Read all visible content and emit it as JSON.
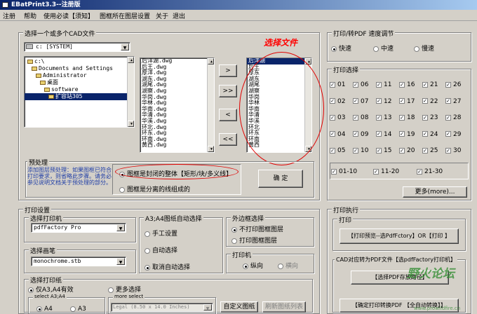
{
  "window": {
    "title": "EBatPrint3.3--注册版"
  },
  "menu": [
    "注册",
    "帮助",
    "使用必读【须知】",
    "图框所在图层设置",
    "关于",
    "退出"
  ],
  "file_section": {
    "label": "选择一个或多个CAD文件",
    "drive": "c: [SYSTEM]",
    "tree": [
      "c:\\",
      "Documents and Settings",
      "Administrator",
      "桌面",
      "software",
      "扩容站305"
    ],
    "files": [
      "后洋湖.dwg",
      "后王.dwg",
      "厚洋.dwg",
      "湖东.dwg",
      "湖尾.dwg",
      "湖察.dwg",
      "华岗.dwg",
      "华林.dwg",
      "华南.dwg",
      "华清.dwg",
      "华溪.dwg",
      "环北.dwg",
      "环东.dwg",
      "环南.dwg",
      "黄西.dwg"
    ],
    "selected_files": [
      "后洋湖",
      "后王",
      "厚东",
      "湖东",
      "湖尾",
      "湖察",
      "华岗",
      "华林",
      "华南",
      "华清",
      "华溪",
      "环北",
      "环东",
      "环南",
      "黄西"
    ],
    "note": "选择文件",
    "buttons": [
      ">",
      ">>",
      "<",
      "<<"
    ]
  },
  "preprocess": {
    "label": "预处理",
    "help": "添加图层预处理：如果图框已符合打印要求，则省略此步骤。请务必参见说明文档关于预处理的部分。",
    "option1": "图框是封闭的整体【矩形/块/多义线】",
    "option2": "图框是分离的线组成的",
    "confirm": "确 定"
  },
  "print_speed": {
    "label": "打印/转PDF 速度调节",
    "options": [
      "快速",
      "中速",
      "慢速"
    ]
  },
  "print_select": {
    "label": "打印选择",
    "rows": [
      [
        "01",
        "06",
        "11",
        "16",
        "21",
        "26"
      ],
      [
        "02",
        "07",
        "12",
        "17",
        "22",
        "27"
      ],
      [
        "03",
        "08",
        "13",
        "18",
        "23",
        "28"
      ],
      [
        "04",
        "09",
        "14",
        "19",
        "24",
        "29"
      ],
      [
        "05",
        "10",
        "15",
        "20",
        "25",
        "30"
      ]
    ],
    "groups": [
      "01-10",
      "11-20",
      "21-30"
    ],
    "more": "更多(more)..."
  },
  "print_settings": {
    "label": "打印设置",
    "printer_label": "选择打印机",
    "printer": "pdfFactory Pro",
    "pen_label": "选择画笔",
    "pen": "monochrome.stb",
    "paper_label": "选择打印纸",
    "paper_opt1": "仅A3,A4有效",
    "paper_opt2": "更多选择",
    "sub_label": "select A3;A4",
    "a4": "A4",
    "a3": "A3",
    "more_select_label": "more select",
    "more_select_value": "Legal (8.50 x 14.0 Inches)",
    "custom_frame": "自定义图纸",
    "refresh": "刷新图纸列表"
  },
  "auto_select": {
    "label": "A3;A4图纸自动选择",
    "options": [
      "手工设置",
      "自动选择",
      "取消自动选择"
    ]
  },
  "outer_frame": {
    "label": "外边框选择",
    "options": [
      "不打印图框图层",
      "打印图框图层"
    ]
  },
  "orientation": {
    "label": "打印机",
    "options": [
      "纵向",
      "横向"
    ]
  },
  "print_exec": {
    "label": "打印执行",
    "print_label": "打印",
    "print_button": "【打印预览--选PdfFctory】OR【打印 】",
    "cad_label": "CAD对应转为PDF文件【选pdfFactory打印机】",
    "pdf_path": "【选择PDF存放路径】",
    "convert_all": "【确定打印转换PDF 【全自动转换】】"
  },
  "watermark": {
    "text": "野火论坛",
    "url": "www.prowildfire.cn"
  }
}
